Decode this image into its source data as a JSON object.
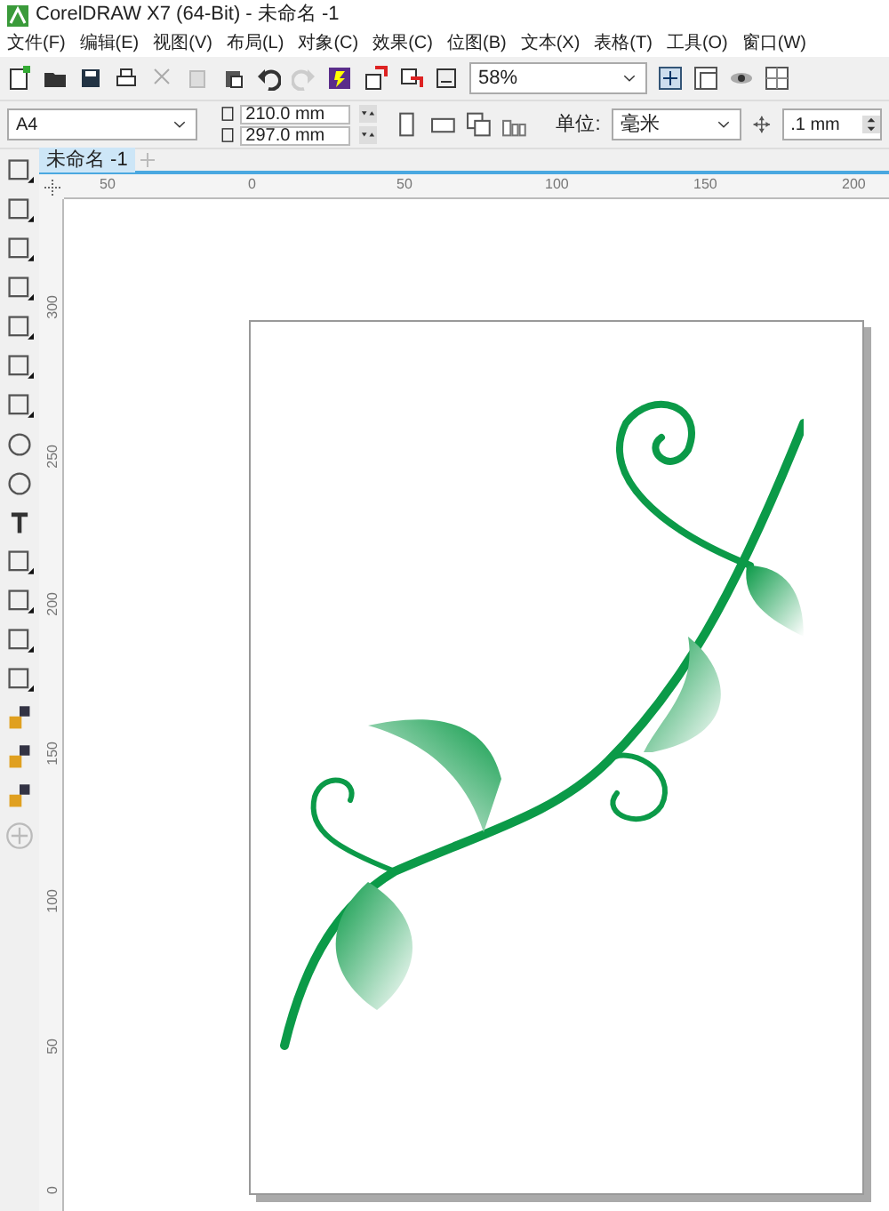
{
  "window": {
    "title": "CorelDRAW X7 (64-Bit) - 未命名 -1"
  },
  "menu": [
    "文件(F)",
    "编辑(E)",
    "视图(V)",
    "布局(L)",
    "对象(C)",
    "效果(C)",
    "位图(B)",
    "文本(X)",
    "表格(T)",
    "工具(O)",
    "窗口(W)"
  ],
  "toolbar": {
    "zoom": "58%"
  },
  "property_bar": {
    "page_size": "A4",
    "width": "210.0 mm",
    "height": "297.0 mm",
    "unit_label": "单位:",
    "unit": "毫米",
    "nudge": ".1 mm"
  },
  "tabs": [
    {
      "label": "未命名 -1",
      "selected": true
    }
  ],
  "horizontal_ruler": [
    "50",
    "0",
    "50",
    "100",
    "150",
    "200"
  ],
  "vertical_ruler": [
    "300",
    "250",
    "200",
    "150",
    "100",
    "50",
    "0"
  ]
}
